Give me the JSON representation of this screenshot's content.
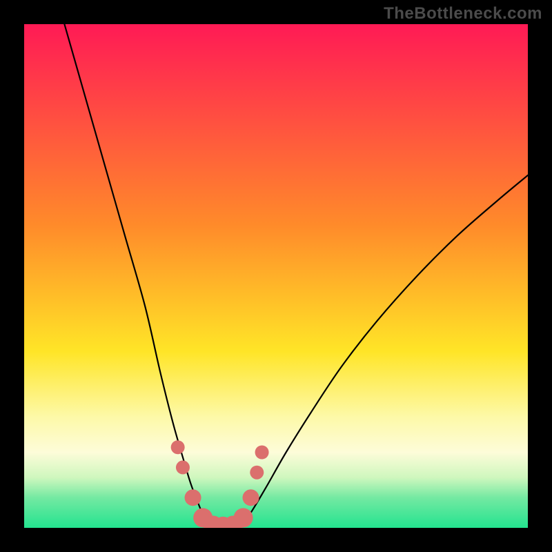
{
  "watermark": "TheBottleneck.com",
  "chart_data": {
    "type": "line",
    "title": "",
    "xlabel": "",
    "ylabel": "",
    "xlim": [
      0,
      100
    ],
    "ylim": [
      0,
      100
    ],
    "grid": false,
    "legend": false,
    "background_gradient": {
      "stops": [
        {
          "offset": 0.0,
          "color": "#ff1a55"
        },
        {
          "offset": 0.4,
          "color": "#ff8b2a"
        },
        {
          "offset": 0.65,
          "color": "#ffe527"
        },
        {
          "offset": 0.78,
          "color": "#fdf9a8"
        },
        {
          "offset": 0.85,
          "color": "#fdfcd9"
        },
        {
          "offset": 0.9,
          "color": "#cff7be"
        },
        {
          "offset": 0.94,
          "color": "#74e9a2"
        },
        {
          "offset": 1.0,
          "color": "#23e38f"
        }
      ]
    },
    "series": [
      {
        "name": "left-arm",
        "x": [
          8,
          12,
          16,
          20,
          24,
          27,
          29.5,
          31.5,
          33,
          34.5,
          35.8,
          37
        ],
        "y": [
          100,
          86,
          72,
          58,
          44,
          31,
          21,
          14,
          9,
          5,
          2,
          0
        ]
      },
      {
        "name": "right-arm",
        "x": [
          43,
          45,
          48,
          52,
          57,
          63,
          70,
          78,
          86,
          94,
          100
        ],
        "y": [
          0,
          3,
          8,
          15,
          23,
          32,
          41,
          50,
          58,
          65,
          70
        ]
      },
      {
        "name": "markers",
        "x": [
          30.5,
          31.5,
          33.5,
          35.5,
          37.5,
          39.5,
          41.5,
          43.5,
          45.0,
          46.2,
          47.2
        ],
        "y": [
          16,
          12,
          6,
          2,
          0.5,
          0.3,
          0.5,
          2,
          6,
          11,
          15
        ],
        "r": [
          10,
          10,
          12,
          14,
          14,
          14,
          14,
          14,
          12,
          10,
          10
        ]
      }
    ]
  }
}
